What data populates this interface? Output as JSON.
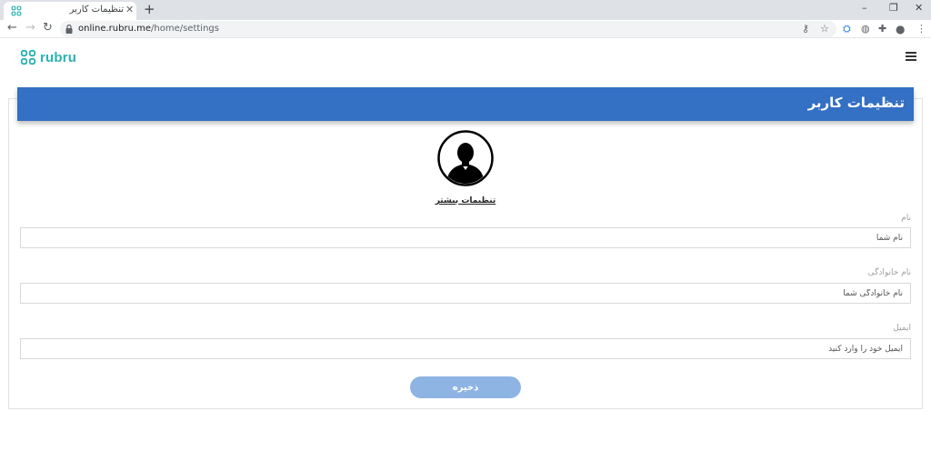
{
  "browser": {
    "tab_title": "تنظیمات کاربر",
    "tab_close": "✕",
    "new_tab": "+",
    "url_host": "online.rubru.me",
    "url_path": "/home/settings",
    "window_controls": {
      "minimize": "–",
      "restore": "❐",
      "close": "✕"
    },
    "icons": [
      "key-icon",
      "star-icon",
      "extension-icon",
      "globe-icon",
      "puzzle-icon",
      "profile-icon",
      "more-icon"
    ]
  },
  "header": {
    "brand": "rubru",
    "brand_color": "#2ab3b1"
  },
  "settings": {
    "title": "تنظیمات کاربر",
    "header_color": "#3470c3",
    "more_settings_link": "تنظیمات بیشتر",
    "fields": [
      {
        "label": "نام",
        "placeholder": "نام شما",
        "value": ""
      },
      {
        "label": "نام خانوادگی",
        "placeholder": "نام خانوادگی شما",
        "value": ""
      },
      {
        "label": "ایمیل",
        "placeholder": "ایمیل خود را وارد کنید",
        "value": ""
      }
    ],
    "save_label": "ذخیره",
    "save_color": "#8eb4e3"
  }
}
